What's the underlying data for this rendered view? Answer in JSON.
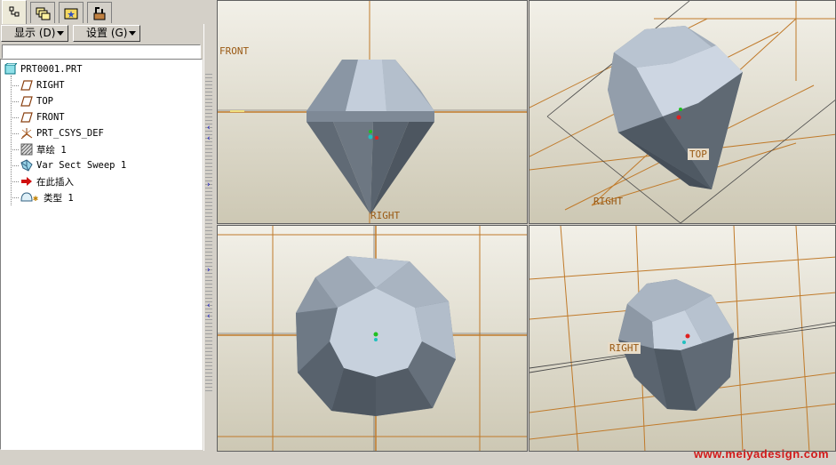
{
  "colors": {
    "model_light": "#c6d0dc",
    "model_dark": "#56606a",
    "datum_plane": "#c07a2a",
    "watermark": "#d21a1a"
  },
  "tabs": [
    {
      "icon": "model-tree-icon",
      "active": true
    },
    {
      "icon": "layers-icon",
      "active": false
    },
    {
      "icon": "favorites-folder-icon",
      "active": false
    },
    {
      "icon": "tools-icon",
      "active": false
    }
  ],
  "menu": {
    "show_label": "显示 (D)",
    "settings_label": "设置 (G)"
  },
  "tree": {
    "root": "PRT0001.PRT",
    "items": [
      {
        "label": "RIGHT",
        "icon": "datum-plane-icon"
      },
      {
        "label": "TOP",
        "icon": "datum-plane-icon"
      },
      {
        "label": "FRONT",
        "icon": "datum-plane-icon"
      },
      {
        "label": "PRT_CSYS_DEF",
        "icon": "coordinate-system-icon"
      },
      {
        "label": "草绘 1",
        "icon": "sketch-icon"
      },
      {
        "label": "Var Sect Sweep 1",
        "icon": "sweep-feature-icon"
      },
      {
        "label": "在此插入",
        "icon": "insert-here-arrow-icon"
      },
      {
        "label": "类型 1",
        "icon": "type-feature-icon"
      }
    ]
  },
  "viewports": {
    "front_view": {
      "plane_labels": [
        "FRONT",
        "RIGHT"
      ]
    },
    "iso_view": {
      "plane_labels": [
        "TOP",
        "RIGHT"
      ]
    },
    "top_view": {
      "plane_labels": []
    },
    "iso_view_2": {
      "plane_labels": [
        "RIGHT"
      ]
    }
  },
  "watermark": "www.meiyadesign.com"
}
